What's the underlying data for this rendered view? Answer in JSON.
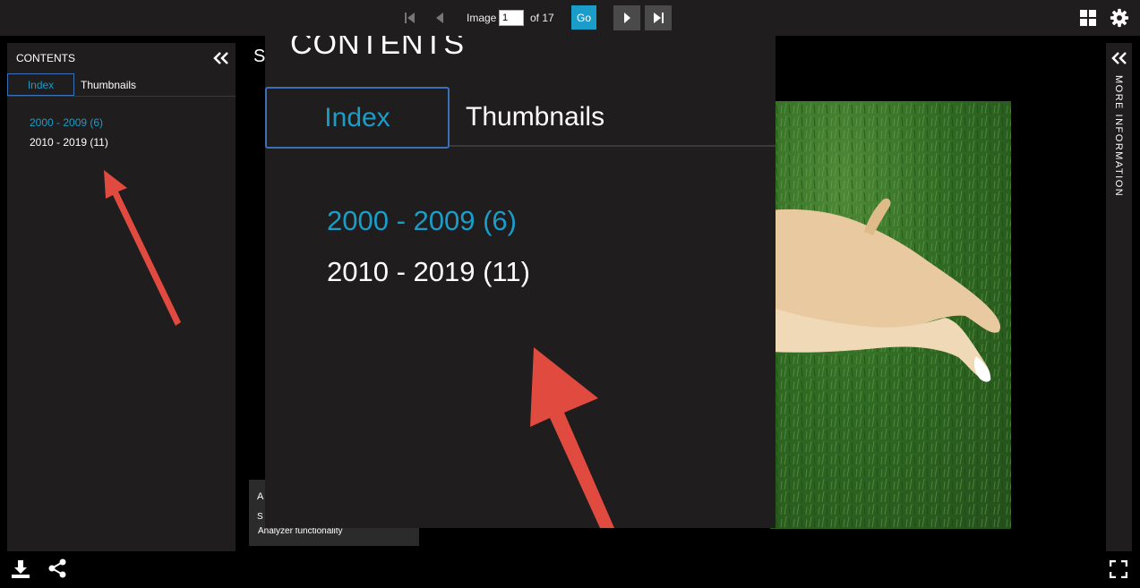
{
  "toolbar": {
    "image_label": "Image",
    "current_image": "1",
    "of_label": "of 17",
    "go_label": "Go",
    "icons": [
      "first-page-icon",
      "previous-icon",
      "next-icon",
      "last-page-icon",
      "grid-view-icon",
      "gear-icon"
    ]
  },
  "contents_panel": {
    "title": "CONTENTS",
    "tabs": [
      {
        "label": "Index",
        "active": true
      },
      {
        "label": "Thumbnails",
        "active": false
      }
    ],
    "items": [
      {
        "label": "2000 - 2009 (6)",
        "selected": true
      },
      {
        "label": "2010 - 2019 (11)",
        "selected": false
      }
    ]
  },
  "viewer": {
    "title_fragment": "S"
  },
  "analyzer": {
    "fragment_a": "A",
    "fragment_s": "S",
    "text": "Analyzer functionality"
  },
  "right_panel": {
    "label": "MORE INFORMATION"
  },
  "colors": {
    "accent": "#1a9dc9",
    "tab_border": "#3b6fb6",
    "panel_bg": "#1f1d1e",
    "annotation_arrow": "#e04a3f"
  },
  "bottom_icons": [
    "download-icon",
    "share-icon",
    "fullscreen-icon"
  ]
}
